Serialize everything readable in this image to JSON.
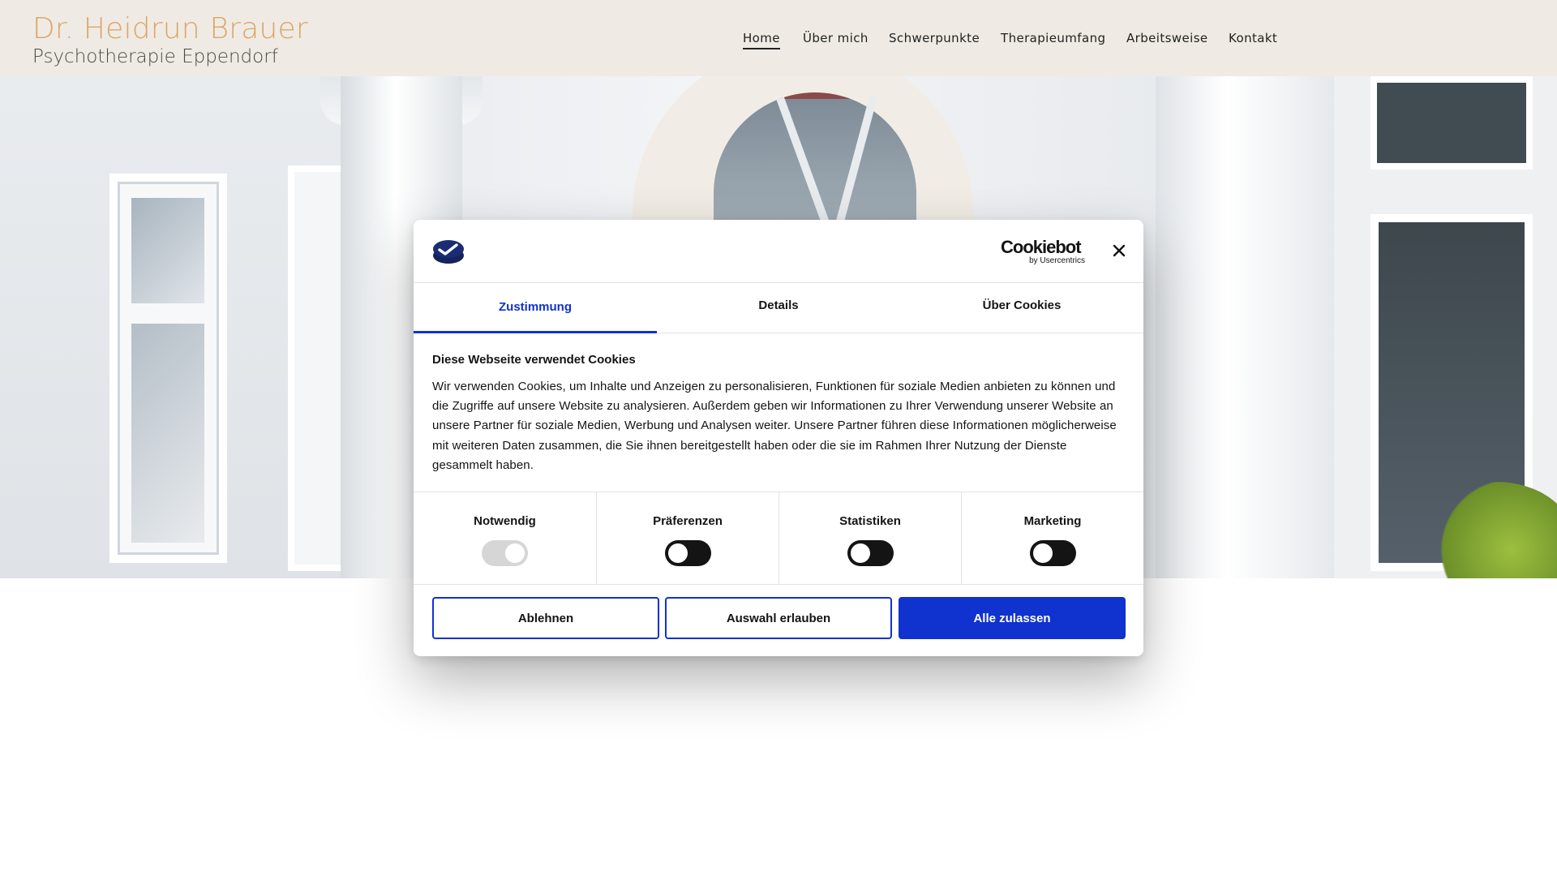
{
  "header": {
    "brand_name": "Dr. Heidrun Brauer",
    "brand_sub": "Psychotherapie Eppendorf",
    "brand_color": "#d9a66b",
    "background": "#efebe4",
    "nav": [
      {
        "label": "Home",
        "active": true
      },
      {
        "label": "Über mich",
        "active": false
      },
      {
        "label": "Schwerpunkte",
        "active": false
      },
      {
        "label": "Therapieumfang",
        "active": false
      },
      {
        "label": "Arbeitsweise",
        "active": false
      },
      {
        "label": "Kontakt",
        "active": false
      }
    ]
  },
  "hero": {
    "image": "building-entrance-photo"
  },
  "cookie_dialog": {
    "logo_icon": "cookiebot-logo-icon",
    "brand_name": "Cookiebot",
    "brand_by": "by Usercentrics",
    "close_icon": "close-icon",
    "accent_color": "#1032cf",
    "tabs": [
      {
        "label": "Zustimmung",
        "active": true
      },
      {
        "label": "Details",
        "active": false
      },
      {
        "label": "Über Cookies",
        "active": false
      }
    ],
    "title": "Diese Webseite verwendet Cookies",
    "text": "Wir verwenden Cookies, um Inhalte und Anzeigen zu personalisieren, Funktionen für soziale Medien anbieten zu können und die Zugriffe auf unsere Website zu analysieren. Außerdem geben wir Informationen zu Ihrer Verwendung unserer Website an unsere Partner für soziale Medien, Werbung und Analysen weiter. Unsere Partner führen diese Informationen möglicherweise mit weiteren Daten zusammen, die Sie ihnen bereitgestellt haben oder die sie im Rahmen Ihrer Nutzung der Dienste gesammelt haben.",
    "categories": [
      {
        "label": "Notwendig",
        "enabled": true,
        "locked": true
      },
      {
        "label": "Präferenzen",
        "enabled": false,
        "locked": false
      },
      {
        "label": "Statistiken",
        "enabled": false,
        "locked": false
      },
      {
        "label": "Marketing",
        "enabled": false,
        "locked": false
      }
    ],
    "buttons": {
      "deny": "Ablehnen",
      "allow_selection": "Auswahl erlauben",
      "allow_all": "Alle zulassen"
    }
  }
}
